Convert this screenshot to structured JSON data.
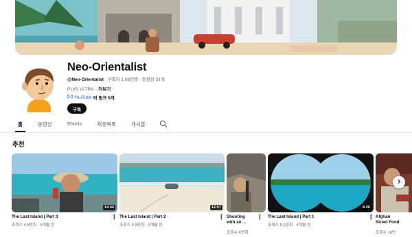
{
  "channel": {
    "name": "Neo-Orientalist",
    "handle": "@Neo-Orientalist",
    "stats": " · 구독자 1.06만명 · 동영상 31개",
    "description": "PLVS VLTRA ...",
    "description_more": "더보기",
    "link_text": "YouTube",
    "link_extra": "외 링크 5개",
    "subscribe_label": "구독"
  },
  "tabs": [
    {
      "label": "홈",
      "active": true
    },
    {
      "label": "동영상"
    },
    {
      "label": "Shorts"
    },
    {
      "label": "재생목록"
    },
    {
      "label": "게시물"
    }
  ],
  "section": {
    "title": "추천"
  },
  "videos": [
    {
      "title": "The Last Island | Part 3",
      "meta": "조회수 4.8만회 · 3개월 전",
      "duration": "14:44"
    },
    {
      "title": "The Last Island | Part 2",
      "meta": "조회수 9.9만회 · 3개월 전",
      "duration": "12:57"
    },
    {
      "title_line1": "Shooting",
      "title_line2": "with an ...",
      "meta": "조회수 6만회"
    },
    {
      "title": "The Last Island | Part 1",
      "meta": "조회수 5.1만회 · 4개월 전",
      "duration": "8:26"
    },
    {
      "title_line1": "Afghan",
      "title_line2": "Street Food",
      "meta": "조회수 18만"
    }
  ],
  "icons": {
    "search": "search-icon",
    "more": "more-vert-icon",
    "next": "chevron-right-icon",
    "link": "link-icon"
  },
  "colors": {
    "subscribe_bg": "#0f0f0f",
    "link": "#065fd4",
    "secondary_text": "#606060"
  }
}
